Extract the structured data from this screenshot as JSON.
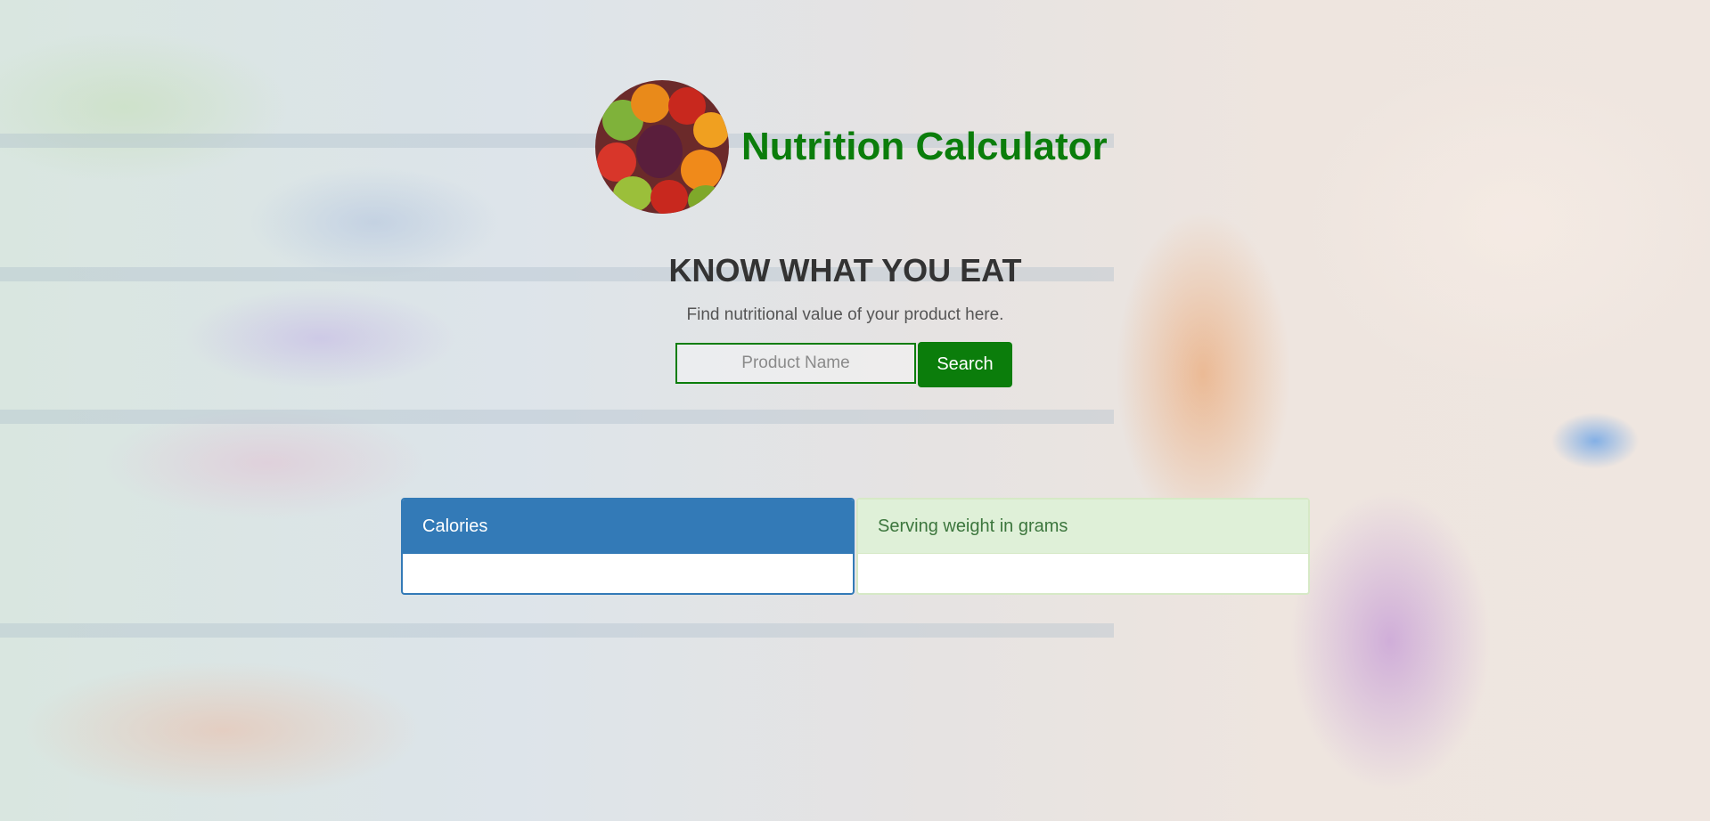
{
  "app": {
    "title": "Nutrition Calculator",
    "logo_icon": "fruit-assortment-logo"
  },
  "hero": {
    "tagline": "KNOW WHAT YOU EAT",
    "subtext": "Find nutritional value of your product here."
  },
  "search": {
    "placeholder": "Product Name",
    "value": "",
    "button_label": "Search"
  },
  "results": {
    "calories": {
      "label": "Calories",
      "value": ""
    },
    "serving_weight": {
      "label": "Serving weight in grams",
      "value": ""
    }
  },
  "colors": {
    "brand_green": "#0b7d0b",
    "panel_primary": "#337ab7",
    "panel_success_bg": "#dff0d8",
    "panel_success_text": "#3c763d"
  }
}
